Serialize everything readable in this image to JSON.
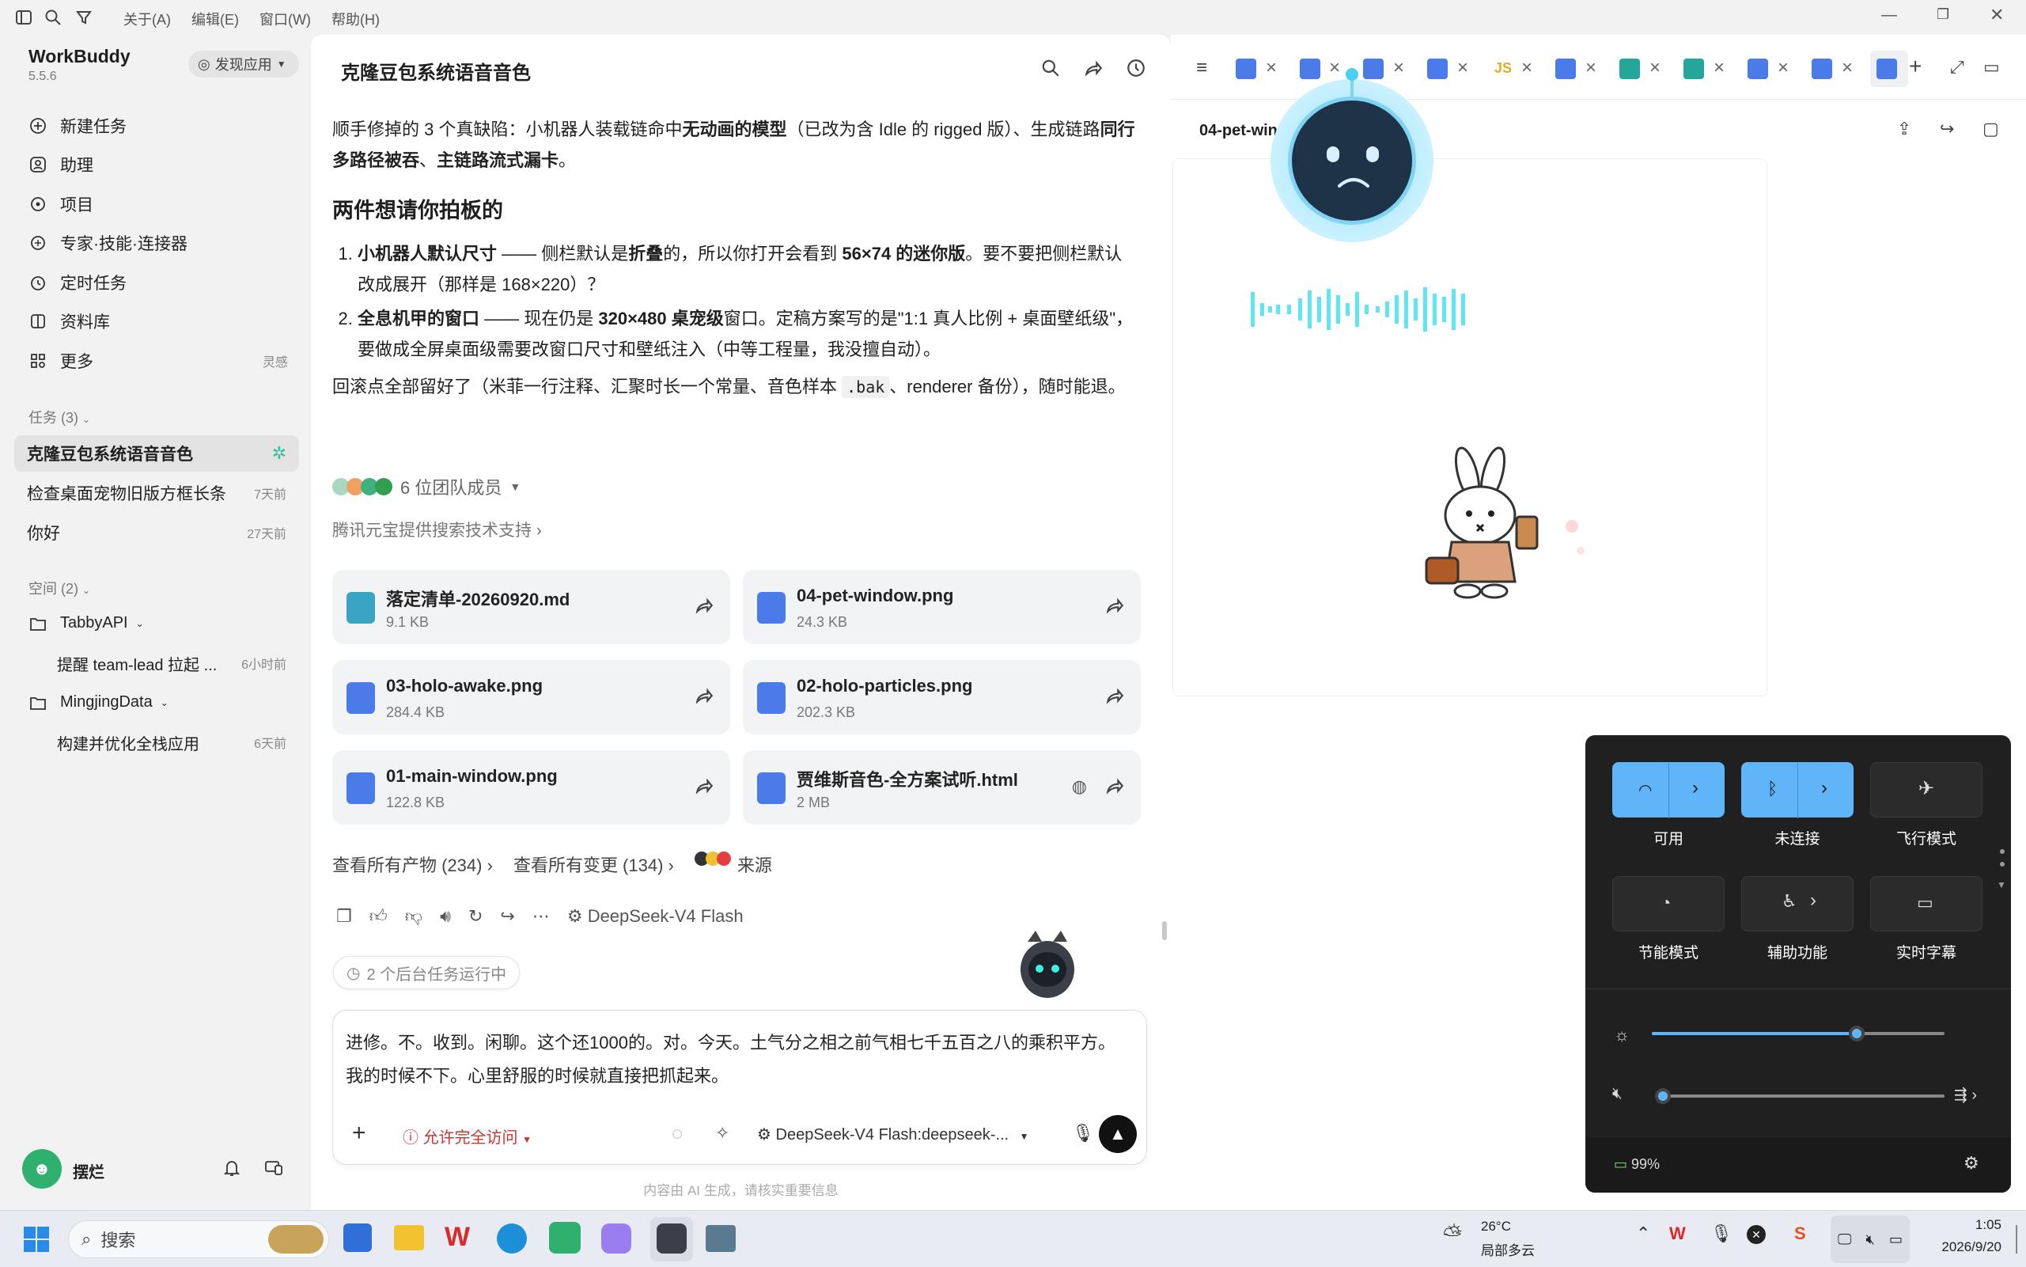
{
  "menu": {
    "about": "关于(A)",
    "edit": "编辑(E)",
    "window": "窗口(W)",
    "help": "帮助(H)"
  },
  "app": {
    "name": "WorkBuddy",
    "version": "5.5.6",
    "discover": "发现应用"
  },
  "nav": {
    "new_task": "新建任务",
    "assistant": "助理",
    "project": "项目",
    "experts": "专家·技能·连接器",
    "scheduled": "定时任务",
    "library": "资料库",
    "more": "更多",
    "more_hint": "灵感"
  },
  "tasks": {
    "header": "任务 (3)",
    "items": [
      {
        "title": "克隆豆包系统语音音色",
        "time": ""
      },
      {
        "title": "检查桌面宠物旧版方框长条",
        "time": "7天前"
      },
      {
        "title": "你好",
        "time": "27天前"
      }
    ]
  },
  "spaces": {
    "header": "空间 (2)",
    "items": [
      {
        "name": "TabbyAPI",
        "sub": "提醒 team-lead 拉起 ...",
        "time": "6小时前"
      },
      {
        "name": "MingjingData",
        "sub": "构建并优化全栈应用",
        "time": "6天前"
      }
    ]
  },
  "user": {
    "name": "摆烂"
  },
  "chat": {
    "title": "克隆豆包系统语音音色",
    "p1_a": "顺手修掉的 3 个真缺陷：小机器人装载链命中",
    "p1_b": "无动画的模型",
    "p1_c": "（已改为含 Idle 的 rigged 版）、生成链路",
    "p1_d": "同行多路径被吞",
    "p1_e": "、",
    "p1_f": "主链路流式漏卡",
    "p1_g": "。",
    "heading": "两件想请你拍板的",
    "li1_a": "小机器人默认尺寸",
    "li1_b": " —— 侧栏默认是",
    "li1_c": "折叠",
    "li1_d": "的，所以你打开会看到 ",
    "li1_e": "56×74 的迷你版",
    "li1_f": "。要不要把侧栏默认改成展开（那样是 168×220）？",
    "li2_a": "全息机甲的窗口",
    "li2_b": " —— 现在仍是 ",
    "li2_c": "320×480 桌宠级",
    "li2_d": "窗口。定稿方案写的是\"1:1 真人比例 + 桌面壁纸级\"，要做成全屏桌面级需要改窗口尺寸和壁纸注入（中等工程量，我没擅自动）。",
    "p3_a": "回滚点全部留好了（米菲一行注释、汇聚时长一个常量、音色样本 ",
    "p3_code": ".bak",
    "p3_b": "、renderer 备份），随时能退。",
    "team": "6 位团队成员",
    "search_support": "腾讯元宝提供搜索技术支持",
    "files": [
      {
        "name": "落定清单-20260920.md",
        "size": "9.1 KB",
        "type": "md"
      },
      {
        "name": "04-pet-window.png",
        "size": "24.3 KB",
        "type": "img"
      },
      {
        "name": "03-holo-awake.png",
        "size": "284.4 KB",
        "type": "img"
      },
      {
        "name": "02-holo-particles.png",
        "size": "202.3 KB",
        "type": "img"
      },
      {
        "name": "01-main-window.png",
        "size": "122.8 KB",
        "type": "img"
      },
      {
        "name": "贾维斯音色-全方案试听.html",
        "size": "2 MB",
        "type": "html"
      }
    ],
    "all_artifacts": "查看所有产物 (234)",
    "all_changes": "查看所有变更 (134)",
    "source": "来源",
    "model_used": "DeepSeek-V4 Flash",
    "bg_tasks": "2 个后台任务运行中",
    "input_text": "进修。不。收到。闲聊。这个还1000的。对。今天。土气分之相之前气相七千五百之八的乘积平方。我的时候不下。心里舒服的时候就直接把抓起来。",
    "access": "允许完全访问",
    "model_select": "DeepSeek-V4 Flash:deepseek-...",
    "disclaimer": "内容由 AI 生成，请核实重要信息"
  },
  "preview": {
    "filename": "04-pet-window.png"
  },
  "quick": {
    "wifi": "可用",
    "bluetooth": "未连接",
    "airplane": "飞行模式",
    "saver": "节能模式",
    "accessibility": "辅助功能",
    "captions": "实时字幕",
    "brightness": 0.7,
    "volume": 0.0,
    "battery": "99%"
  },
  "taskbar": {
    "search": "搜索",
    "weather_temp": "26°C",
    "weather_desc": "局部多云",
    "time": "1:05",
    "date": "2026/9/20"
  },
  "colors": {
    "accent": "#3fa0f5",
    "cyan": "#4fe0f0",
    "wifi_on": "#60b4f8"
  }
}
